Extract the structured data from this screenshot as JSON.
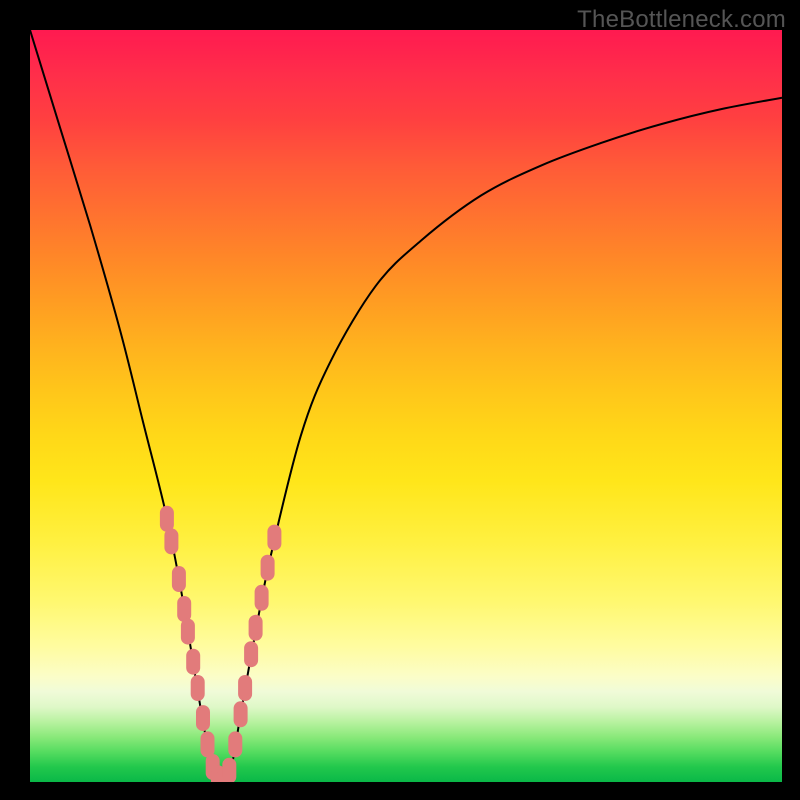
{
  "watermark": "TheBottleneck.com",
  "colors": {
    "frame": "#000000",
    "curve": "#000000",
    "marker": "#e27b7b",
    "band_green": "#18c050",
    "band_yellow": "#fff250",
    "band_red": "#ff1e4a"
  },
  "chart_data": {
    "type": "line",
    "title": "",
    "xlabel": "",
    "ylabel": "",
    "xlim": [
      0,
      100
    ],
    "ylim": [
      0,
      100
    ],
    "grid": false,
    "legend": false,
    "annotations": [
      "TheBottleneck.com"
    ],
    "series": [
      {
        "name": "bottleneck-curve",
        "x": [
          0,
          4,
          8,
          12,
          15,
          18,
          20,
          22,
          23,
          24,
          25,
          26,
          27,
          28,
          30,
          32,
          36,
          40,
          46,
          52,
          60,
          68,
          76,
          84,
          92,
          100
        ],
        "y": [
          100,
          87,
          74,
          60,
          48,
          36,
          26,
          14,
          8,
          3,
          0,
          0,
          3,
          9,
          20,
          30,
          46,
          56,
          66,
          72,
          78,
          82,
          85,
          87.5,
          89.5,
          91
        ]
      }
    ],
    "markers": {
      "name": "sample-points",
      "points": [
        {
          "x": 18.2,
          "y": 35.0
        },
        {
          "x": 18.8,
          "y": 32.0
        },
        {
          "x": 19.8,
          "y": 27.0
        },
        {
          "x": 20.5,
          "y": 23.0
        },
        {
          "x": 21.0,
          "y": 20.0
        },
        {
          "x": 21.7,
          "y": 16.0
        },
        {
          "x": 22.3,
          "y": 12.5
        },
        {
          "x": 23.0,
          "y": 8.5
        },
        {
          "x": 23.6,
          "y": 5.0
        },
        {
          "x": 24.3,
          "y": 2.0
        },
        {
          "x": 25.0,
          "y": 0.5
        },
        {
          "x": 25.8,
          "y": 0.3
        },
        {
          "x": 26.5,
          "y": 1.5
        },
        {
          "x": 27.3,
          "y": 5.0
        },
        {
          "x": 28.0,
          "y": 9.0
        },
        {
          "x": 28.6,
          "y": 12.5
        },
        {
          "x": 29.4,
          "y": 17.0
        },
        {
          "x": 30.0,
          "y": 20.5
        },
        {
          "x": 30.8,
          "y": 24.5
        },
        {
          "x": 31.6,
          "y": 28.5
        },
        {
          "x": 32.5,
          "y": 32.5
        }
      ]
    }
  }
}
